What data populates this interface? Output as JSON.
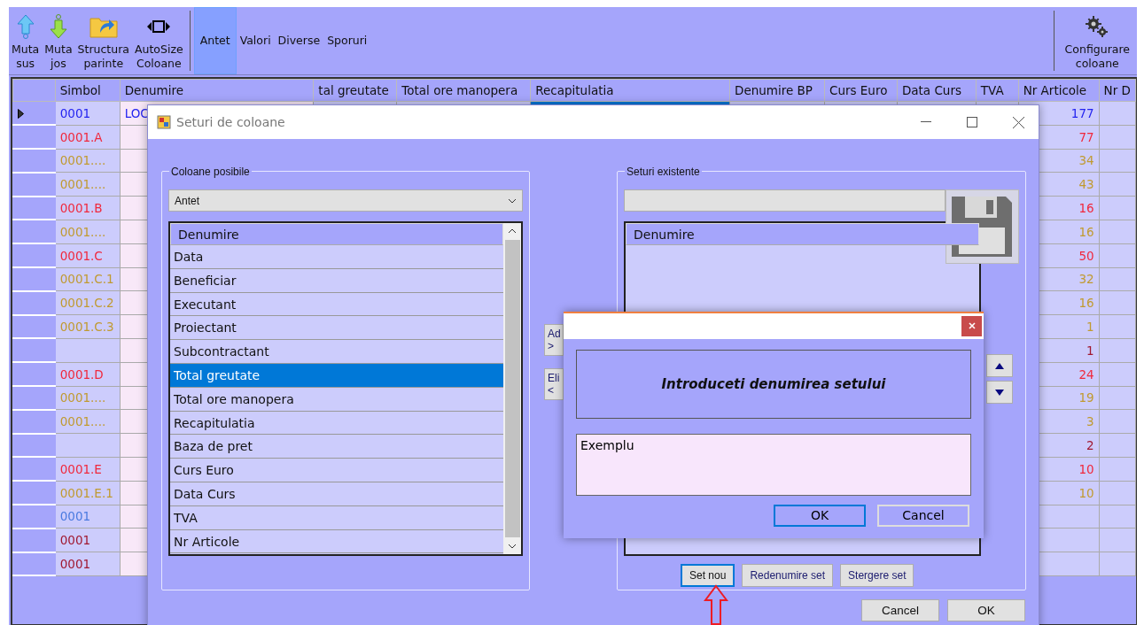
{
  "toolbar": {
    "buttons": [
      {
        "kind": "up",
        "label": "Muta\nsus"
      },
      {
        "kind": "down",
        "label": "Muta\njos"
      },
      {
        "kind": "folder",
        "label": "Structura\nparinte"
      },
      {
        "kind": "autosize",
        "label": "AutoSize\nColoane"
      }
    ],
    "tabs": [
      {
        "label": "Antet",
        "selected": true
      },
      {
        "label": "Valori",
        "selected": false
      },
      {
        "label": "Diverse",
        "selected": false
      },
      {
        "label": "Sporuri",
        "selected": false
      }
    ],
    "config_button": {
      "label": "Configurare\ncoloane"
    }
  },
  "grid": {
    "columns": [
      "Simbol",
      "Denumire",
      "tal greutate",
      "Total ore manopera",
      "Recapitulatia",
      "Denumire BP",
      "Curs Euro",
      "Data Curs",
      "TVA",
      "Nr Articole",
      "Nr D"
    ],
    "rows": [
      {
        "current": true,
        "simbol": "0001",
        "denumire": "LOC",
        "nr_articole": "177",
        "color": "#2424f0"
      },
      {
        "current": false,
        "simbol": "0001.A",
        "nr_articole": "77",
        "color": "#f0283c"
      },
      {
        "current": false,
        "simbol": "0001....",
        "nr_articole": "34",
        "color": "#c09a30"
      },
      {
        "current": false,
        "simbol": "0001....",
        "nr_articole": "43",
        "color": "#c09a30"
      },
      {
        "current": false,
        "simbol": "0001.B",
        "nr_articole": "16",
        "color": "#f0283c"
      },
      {
        "current": false,
        "simbol": "0001....",
        "nr_articole": "16",
        "color": "#c09a30"
      },
      {
        "current": false,
        "simbol": "0001.C",
        "nr_articole": "50",
        "color": "#f0283c"
      },
      {
        "current": false,
        "simbol": "0001.C.1",
        "nr_articole": "32",
        "color": "#c09a30"
      },
      {
        "current": false,
        "simbol": "0001.C.2",
        "nr_articole": "16",
        "color": "#c09a30"
      },
      {
        "current": false,
        "simbol": "0001.C.3",
        "nr_articole": "1",
        "color": "#c09a30"
      },
      {
        "current": false,
        "nr_articole": "1",
        "color": "#a01830"
      },
      {
        "current": false,
        "simbol": "0001.D",
        "nr_articole": "24",
        "color": "#f0283c"
      },
      {
        "current": false,
        "simbol": "0001....",
        "nr_articole": "19",
        "color": "#c09a30"
      },
      {
        "current": false,
        "simbol": "0001....",
        "nr_articole": "3",
        "color": "#c09a30"
      },
      {
        "current": false,
        "nr_articole": "2",
        "color": "#a01830"
      },
      {
        "current": false,
        "simbol": "0001.E",
        "nr_articole": "10",
        "color": "#f0283c"
      },
      {
        "current": false,
        "simbol": "0001.E.1",
        "nr_articole": "10",
        "color": "#c09a30"
      },
      {
        "current": false,
        "simbol": "0001",
        "color": "#4a7ae0"
      },
      {
        "current": false,
        "simbol": "0001",
        "color": "#a01830"
      },
      {
        "current": false,
        "simbol": "0001",
        "color": "#a01830"
      }
    ]
  },
  "dialog": {
    "title": "Seturi de coloane",
    "left_group": {
      "title": "Coloane posibile",
      "dropdown": "Antet",
      "list_header": "Denumire",
      "items": [
        {
          "label": "Data",
          "selected": false
        },
        {
          "label": "Beneficiar",
          "selected": false
        },
        {
          "label": "Executant",
          "selected": false
        },
        {
          "label": "Proiectant",
          "selected": false
        },
        {
          "label": "Subcontractant",
          "selected": false
        },
        {
          "label": "Total greutate",
          "selected": true
        },
        {
          "label": "Total ore manopera",
          "selected": false
        },
        {
          "label": "Recapitulatia",
          "selected": false
        },
        {
          "label": "Baza de pret",
          "selected": false
        },
        {
          "label": "Curs Euro",
          "selected": false
        },
        {
          "label": "Data Curs",
          "selected": false
        },
        {
          "label": "TVA",
          "selected": false
        },
        {
          "label": "Nr Articole",
          "selected": false
        }
      ]
    },
    "middle_buttons": [
      "Ad\n>",
      "Eli\n<"
    ],
    "right_group": {
      "title": "Seturi existente",
      "list_header": "Denumire",
      "buttons": [
        {
          "label": "Set nou",
          "focused": true
        },
        {
          "label": "Redenumire set",
          "focused": false
        },
        {
          "label": "Stergere set",
          "focused": false
        }
      ]
    },
    "buttons": [
      "Cancel",
      "OK"
    ]
  },
  "popup": {
    "prompt": "Introduceti denumirea setului",
    "value": "Exemplu",
    "buttons": [
      {
        "label": "OK",
        "focused": true
      },
      {
        "label": "Cancel",
        "focused": false
      }
    ]
  }
}
